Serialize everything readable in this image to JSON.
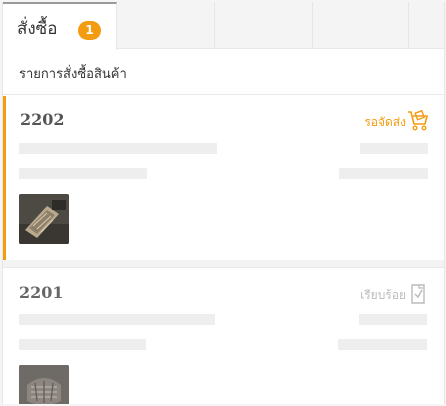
{
  "tabs": {
    "active_label": "สั่งซื้อ",
    "active_badge": "1"
  },
  "section": {
    "title": "รายการสั่งซื้อสินค้า"
  },
  "orders": [
    {
      "id": "2202",
      "status": "รอจัดส่ง",
      "status_icon": "delivery-cart-icon",
      "status_color": "#f39c12"
    },
    {
      "id": "2201",
      "status": "เรียบร้อย",
      "status_icon": "check-document-icon",
      "status_color": "#bbbbbb"
    }
  ],
  "colors": {
    "accent": "#f39c12",
    "placeholder": "#eeeeee"
  }
}
